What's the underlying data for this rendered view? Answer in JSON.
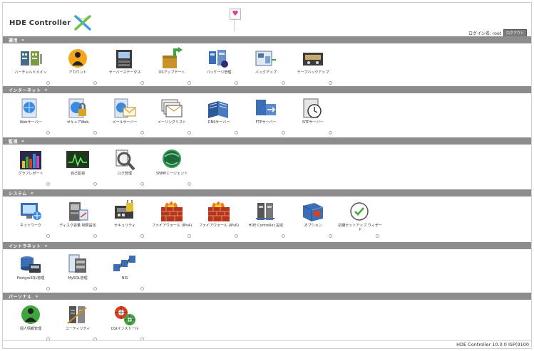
{
  "header": {
    "brand": "HDE Controller",
    "brand_mark": "x-logo",
    "favorite_icon": "heart-icon",
    "login_label": "ログイン名: root",
    "logout_label": "ログアウト"
  },
  "sections": [
    {
      "title": "運用",
      "items": [
        {
          "label": "バーチャルドメイン",
          "icon": "virtual-domain-icon"
        },
        {
          "label": "アカウント",
          "icon": "account-icon"
        },
        {
          "label": "サーバーステータス",
          "icon": "server-status-icon"
        },
        {
          "label": "OSアップデート",
          "icon": "os-update-icon"
        },
        {
          "label": "パッケージ管理",
          "icon": "package-management-icon"
        },
        {
          "label": "バックアップ",
          "icon": "backup-icon"
        },
        {
          "label": "テープバックアップ",
          "icon": "tape-backup-icon"
        }
      ]
    },
    {
      "title": "インターネット",
      "items": [
        {
          "label": "Webサーバー",
          "icon": "web-server-icon"
        },
        {
          "label": "セキュアWeb",
          "icon": "secure-web-icon"
        },
        {
          "label": "メールサーバー",
          "icon": "mail-server-icon"
        },
        {
          "label": "メーリングリスト",
          "icon": "mailing-list-icon"
        },
        {
          "label": "DNSサーバー",
          "icon": "dns-server-icon"
        },
        {
          "label": "FTPサーバー",
          "icon": "ftp-server-icon"
        },
        {
          "label": "NTPサーバー",
          "icon": "ntp-server-icon"
        }
      ]
    },
    {
      "title": "監視",
      "items": [
        {
          "label": "グラフレポート",
          "icon": "graph-report-icon"
        },
        {
          "label": "自己監視",
          "icon": "self-monitor-icon"
        },
        {
          "label": "ログ管理",
          "icon": "log-management-icon"
        },
        {
          "label": "SNMPエージェント",
          "icon": "snmp-agent-icon"
        }
      ]
    },
    {
      "title": "システム",
      "items": [
        {
          "label": "ネットワーク",
          "icon": "network-icon"
        },
        {
          "label": "ディスク容量 制限設定",
          "icon": "disk-quota-icon"
        },
        {
          "label": "セキュリティ",
          "icon": "security-icon"
        },
        {
          "label": "ファイアウォール (IPv4)",
          "icon": "firewall-ipv4-icon"
        },
        {
          "label": "ファイアウォール (IPv6)",
          "icon": "firewall-ipv6-icon"
        },
        {
          "label": "HDE Controller 設定",
          "icon": "controller-settings-icon"
        },
        {
          "label": "オプション",
          "icon": "option-icon"
        },
        {
          "label": "初期セットアップ ウィザード",
          "icon": "setup-wizard-icon"
        }
      ]
    },
    {
      "title": "イントラネット",
      "items": [
        {
          "label": "PostgreSQL管理",
          "icon": "postgresql-icon"
        },
        {
          "label": "MySQL管理",
          "icon": "mysql-icon"
        },
        {
          "label": "NIS",
          "icon": "nis-icon"
        }
      ]
    },
    {
      "title": "パーソナル",
      "items": [
        {
          "label": "個人情報管理",
          "icon": "personal-info-icon"
        },
        {
          "label": "ユーティリティ",
          "icon": "utility-icon"
        },
        {
          "label": "CGIインストール",
          "icon": "cgi-install-icon"
        }
      ]
    }
  ],
  "footer": {
    "version": "HDE Controller 10.0.0 ISP(9100"
  },
  "colors": {
    "section_bar": "#8d8d8d",
    "accent_blue": "#3a6fb8",
    "firewall_red": "#d8401f"
  }
}
